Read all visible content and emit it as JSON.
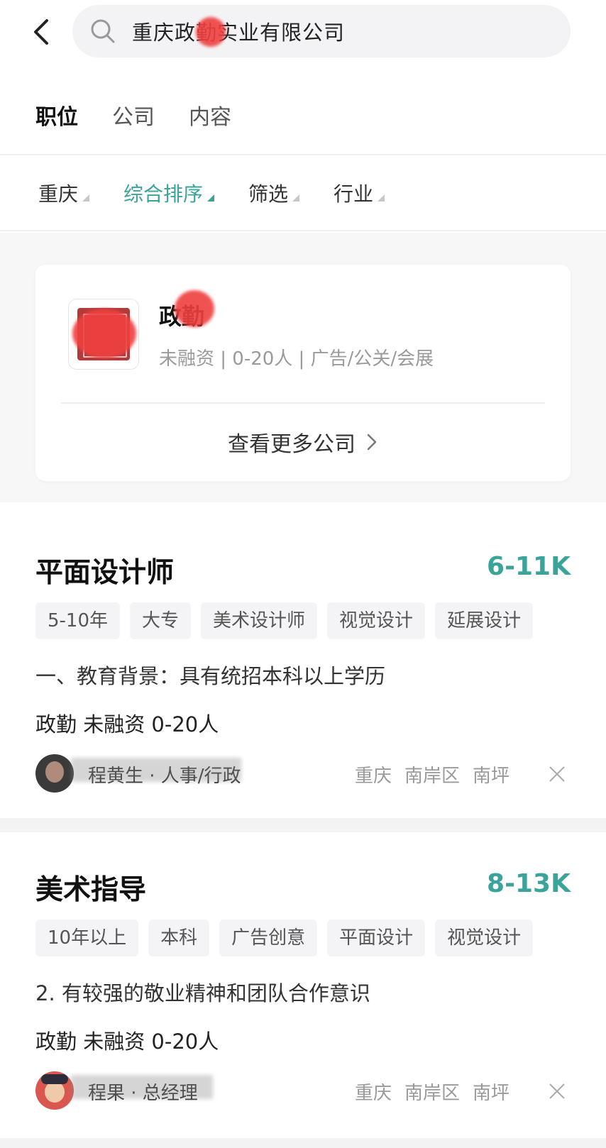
{
  "search": {
    "query": "重庆政勤实业有限公司"
  },
  "tabs": [
    "职位",
    "公司",
    "内容"
  ],
  "filters": [
    "重庆",
    "综合排序",
    "筛选",
    "行业"
  ],
  "company_card": {
    "name": "政勤",
    "meta": "未融资 | 0-20人 | 广告/公关/会展",
    "more_label": "查看更多公司"
  },
  "jobs": [
    {
      "title": "平面设计师",
      "salary": "6-11K",
      "tags": [
        "5-10年",
        "大专",
        "美术设计师",
        "视觉设计",
        "延展设计"
      ],
      "desc": "一、教育背景：具有统招本科以上学历",
      "company": "政勤  未融资  0-20人",
      "recruiter": "程黄生 · 人事/行政",
      "location": [
        "重庆",
        "南岸区",
        "南坪"
      ]
    },
    {
      "title": "美术指导",
      "salary": "8-13K",
      "tags": [
        "10年以上",
        "本科",
        "广告创意",
        "平面设计",
        "视觉设计"
      ],
      "desc": "2. 有较强的敬业精神和团队合作意识",
      "company": "政勤  未融资  0-20人",
      "recruiter": "程果 · 总经理",
      "location": [
        "重庆",
        "南岸区",
        "南坪"
      ]
    }
  ],
  "colors": {
    "accent": "#3aa39a",
    "redaction": "#ef4040"
  },
  "icons": [
    "back-arrow-icon",
    "search-icon",
    "chevron-right-icon",
    "close-icon",
    "sort-triangle-icon"
  ]
}
